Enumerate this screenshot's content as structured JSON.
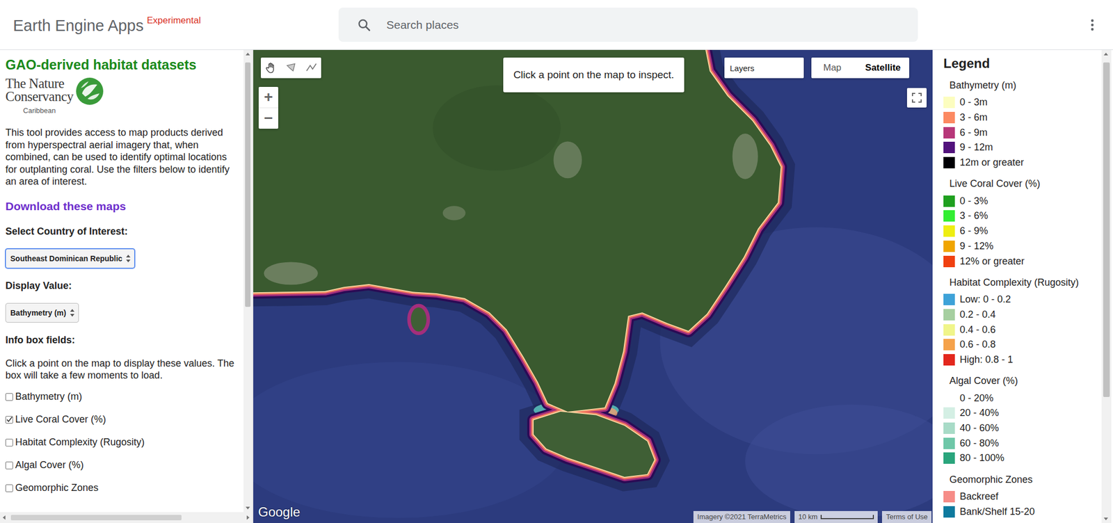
{
  "topbar": {
    "title": "Earth Engine Apps",
    "badge": "Experimental",
    "search": {
      "placeholder": "Search places"
    }
  },
  "sidebar": {
    "heading": "GAO-derived habitat datasets",
    "logo": {
      "line1": "The Nature",
      "line2": "Conservancy",
      "region": "Caribbean"
    },
    "intro": "This tool provides access to map products derived from hyperspectral aerial imagery that, when combined, can be used to identify optimal locations for outplanting coral. Use the filters below to identify an area of interest.",
    "download_link": "Download these maps",
    "country": {
      "label": "Select Country of Interest:",
      "value": "Southeast Dominican Republic",
      "focused": true
    },
    "display": {
      "label": "Display Value:",
      "value": "Bathymetry (m)"
    },
    "info": {
      "label": "Info box fields:",
      "help": "Click a point on the map to display these values. The box will take a few moments to load.",
      "fields": [
        {
          "label": "Bathymetry (m)",
          "checked": false
        },
        {
          "label": "Live Coral Cover (%)",
          "checked": true
        },
        {
          "label": "Habitat Complexity (Rugosity)",
          "checked": false
        },
        {
          "label": "Algal Cover (%)",
          "checked": false
        },
        {
          "label": "Geomorphic Zones",
          "checked": false
        }
      ]
    }
  },
  "map": {
    "inspect_hint": "Click a point on the map to inspect.",
    "layers_label": "Layers",
    "map_types": [
      {
        "label": "Map",
        "selected": false
      },
      {
        "label": "Satellite",
        "selected": true
      }
    ],
    "zoom_in": "+",
    "zoom_out": "−",
    "google": "Google",
    "attribution": "Imagery ©2021 TerraMetrics",
    "scale": "10 km",
    "terms": "Terms of Use"
  },
  "legend": {
    "title": "Legend",
    "sections": [
      {
        "title": "Bathymetry (m)",
        "items": [
          {
            "label": "0 - 3m",
            "color": "#fcfdbf"
          },
          {
            "label": "3 - 6m",
            "color": "#fc8961"
          },
          {
            "label": "6 - 9m",
            "color": "#b73779"
          },
          {
            "label": "9 - 12m",
            "color": "#51127c"
          },
          {
            "label": "12m or greater",
            "color": "#000004"
          }
        ]
      },
      {
        "title": "Live Coral Cover (%)",
        "items": [
          {
            "label": "0 - 3%",
            "color": "#1fa01f"
          },
          {
            "label": "3 - 6%",
            "color": "#33ee33"
          },
          {
            "label": "6 - 9%",
            "color": "#eeee11"
          },
          {
            "label": "9 - 12%",
            "color": "#f0a500"
          },
          {
            "label": "12% or greater",
            "color": "#f04010"
          }
        ]
      },
      {
        "title": "Habitat Complexity (Rugosity)",
        "items": [
          {
            "label": "Low: 0 - 0.2",
            "color": "#3ea2d8"
          },
          {
            "label": "0.2 - 0.4",
            "color": "#a6cfa0"
          },
          {
            "label": "0.4 - 0.6",
            "color": "#f0f58a"
          },
          {
            "label": "0.6 - 0.8",
            "color": "#f5a24a"
          },
          {
            "label": "High: 0.8 - 1",
            "color": "#e3271d"
          }
        ]
      },
      {
        "title": "Algal Cover (%)",
        "items": [
          {
            "label": "0 - 20%",
            "color": "#ffffff"
          },
          {
            "label": "20 - 40%",
            "color": "#d4efe4"
          },
          {
            "label": "40 - 60%",
            "color": "#a8dbc7"
          },
          {
            "label": "60 - 80%",
            "color": "#6ec7a8"
          },
          {
            "label": "80 - 100%",
            "color": "#2aa57c"
          }
        ]
      },
      {
        "title": "Geomorphic Zones",
        "items": [
          {
            "label": "Backreef",
            "color": "#f68c87"
          },
          {
            "label": "Bank/Shelf 15-20",
            "color": "#0e7a9e"
          }
        ]
      }
    ]
  }
}
